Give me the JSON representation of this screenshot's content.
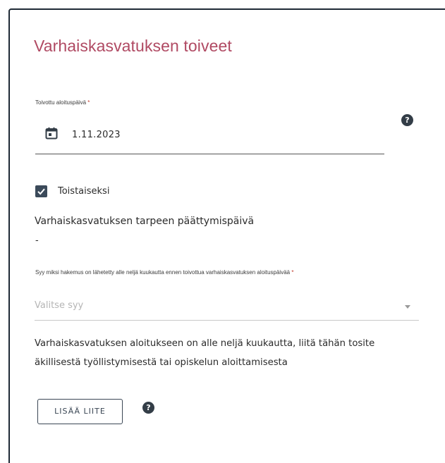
{
  "section": {
    "title": "Varhaiskasvatuksen toiveet"
  },
  "start_date": {
    "label": "Toivottu aloituspäivä",
    "required_mark": "*",
    "value": "1.11.2023",
    "icon": "calendar-icon",
    "help_icon": "help-icon"
  },
  "until_further_notice": {
    "label": "Toistaiseksi",
    "checked": true
  },
  "end_date": {
    "heading": "Varhaiskasvatuksen tarpeen päättymispäivä",
    "value": "-"
  },
  "reason": {
    "label": "Syy miksi hakemus on lähetetty alle neljä kuukautta ennen toivottua varhaiskasvatuksen aloituspäivää",
    "required_mark": "*",
    "placeholder": "Valitse syy"
  },
  "info": {
    "text": "Varhaiskasvatuksen aloitukseen on alle neljä kuukautta, liitä tähän tosite äkillisestä työllistymisestä tai opiskelun aloittamisesta"
  },
  "attachment": {
    "button_label": "LISÄÄ LIITE",
    "help_icon": "help-icon"
  },
  "colors": {
    "title": "#b04a63",
    "dark": "#333d47",
    "border": "#1f2a36",
    "placeholder": "#b5b5b5"
  }
}
